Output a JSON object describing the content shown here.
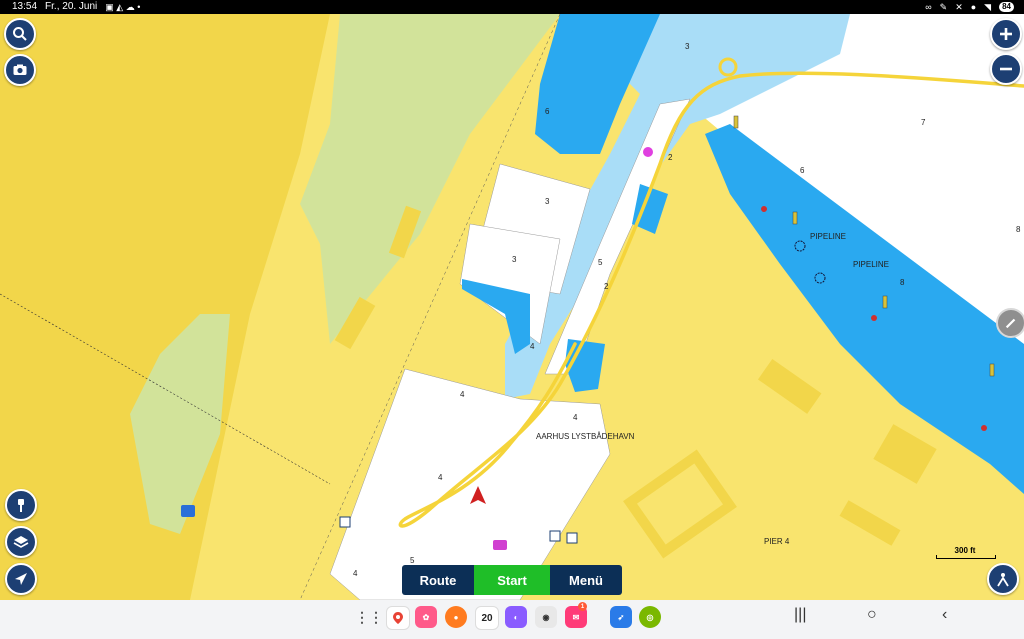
{
  "status_bar": {
    "time": "13:54",
    "date": "Fr., 20. Juni",
    "battery": "84"
  },
  "map": {
    "labels": {
      "harbor": "AARHUS LYSTBÅDEHAVN",
      "pipeline_1": "PIPELINE",
      "pipeline_2": "PIPELINE",
      "pier": "PIER 4"
    },
    "depths": [
      "3",
      "4",
      "6",
      "2",
      "2",
      "3",
      "3",
      "5",
      "2",
      "2",
      "4",
      "4",
      "4",
      "4",
      "4",
      "5",
      "4",
      "7",
      "4",
      "6",
      "3",
      "8",
      "4",
      "8",
      "5"
    ],
    "scale_label": "300 ft"
  },
  "controls": {
    "search_icon": "search-icon",
    "camera_icon": "camera-icon",
    "zoom_in_icon": "plus-icon",
    "zoom_out_icon": "minus-icon",
    "pin_icon": "pin-icon",
    "layers_icon": "layers-icon",
    "locate_icon": "navigation-arrow-icon",
    "edit_icon": "pencil-icon",
    "person_icon": "person-icon"
  },
  "bottom_bar": {
    "route_label": "Route",
    "start_label": "Start",
    "menu_label": "Menü"
  },
  "dock": {
    "calendar_day": "20",
    "badge_count": "1"
  },
  "colors": {
    "land": "#f9e46e",
    "land_dark": "#f2d64a",
    "deep_water": "#2aa9f0",
    "shallow_water": "#a9ddf7",
    "open_water": "#ffffff",
    "green_area": "#d2e39a",
    "route": "#f5d43a",
    "button_navy": "#1d3f73",
    "start_green": "#1fbe28"
  }
}
